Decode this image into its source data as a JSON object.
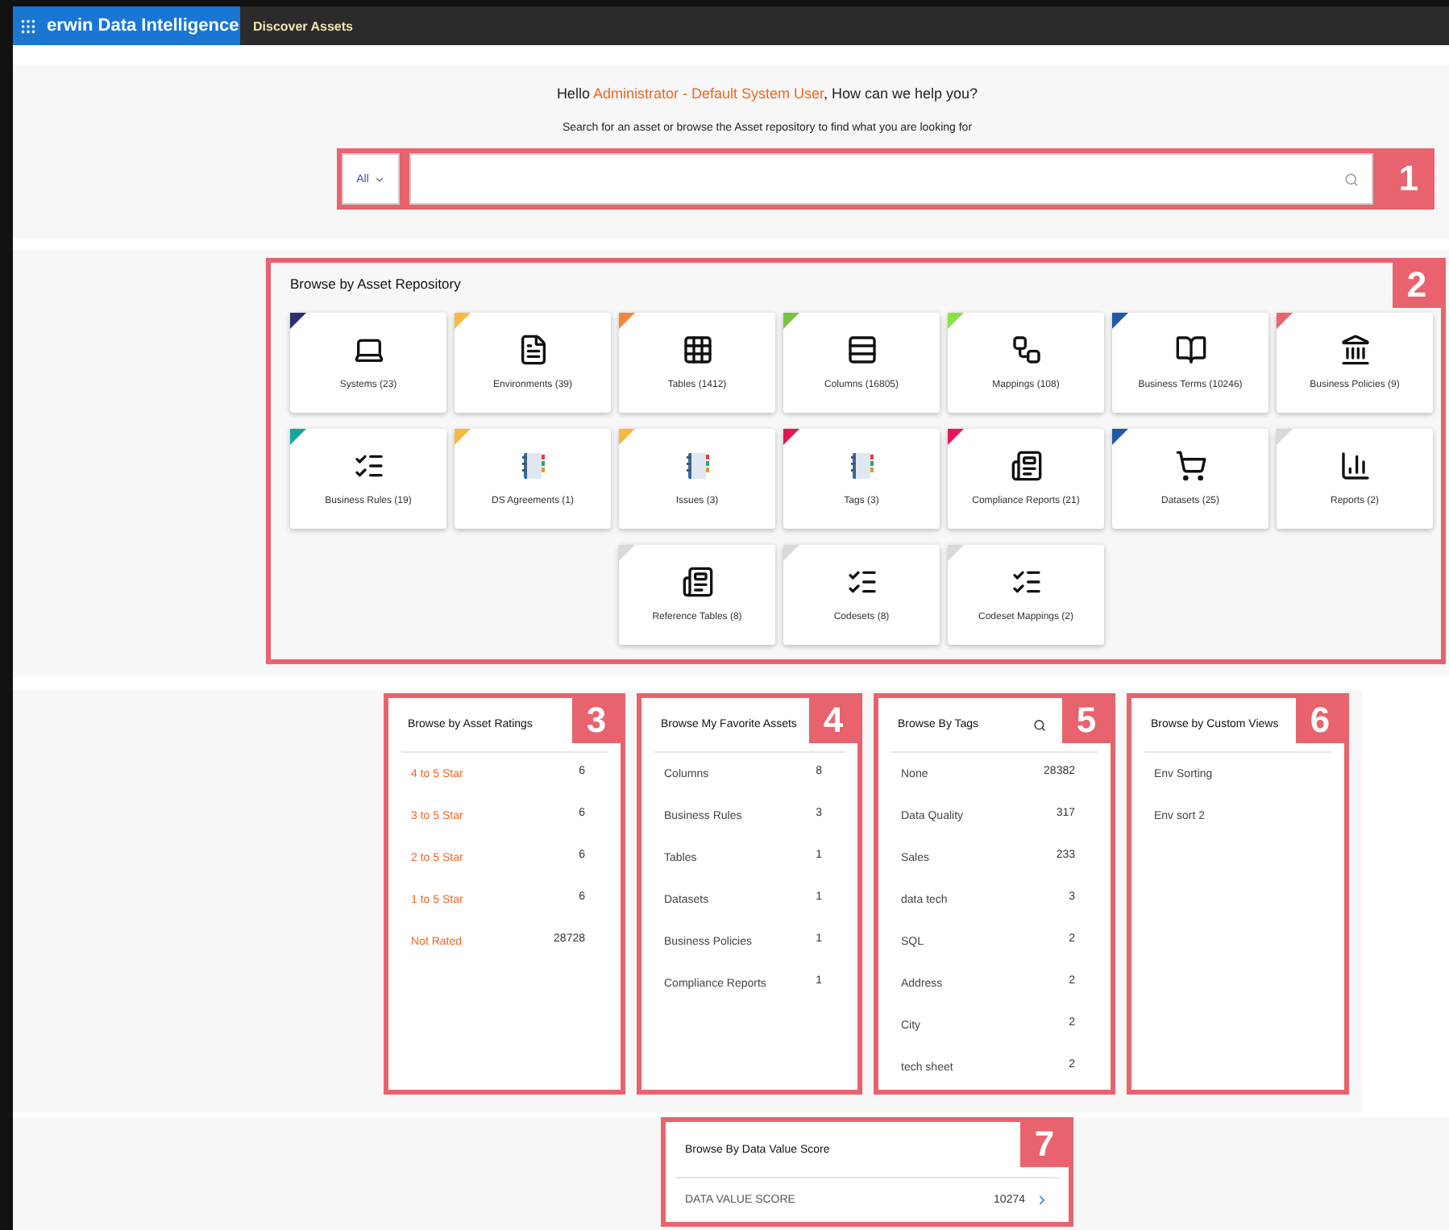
{
  "topbar": {
    "app_title": "erwin Data Intelligence",
    "nav": [
      {
        "label": "Discover Assets"
      }
    ]
  },
  "greeting": {
    "prefix": "Hello ",
    "user": "Administrator - Default System User",
    "suffix": ", How can we help you?"
  },
  "subtitle": "Search for an asset or browse the Asset repository to find what you are looking for",
  "search": {
    "scope": "All",
    "callout": "1"
  },
  "repository": {
    "title": "Browse by Asset Repository",
    "callout": "2",
    "cards": [
      {
        "label": "Systems (23)",
        "kind": "laptop",
        "color": "#2a2f6e"
      },
      {
        "label": "Environments (39)",
        "kind": "document",
        "color": "#f5b942"
      },
      {
        "label": "Tables (1412)",
        "kind": "table",
        "color": "#f0883a"
      },
      {
        "label": "Columns (16805)",
        "kind": "columns",
        "color": "#7cc242"
      },
      {
        "label": "Mappings (108)",
        "kind": "mapping",
        "color": "#8be04a"
      },
      {
        "label": "Business Terms (10246)",
        "kind": "book",
        "color": "#1f5aa6"
      },
      {
        "label": "Business Policies (9)",
        "kind": "bank",
        "color": "#e8636e"
      },
      {
        "label": "Business Rules (19)",
        "kind": "checklist",
        "color": "#14a89a"
      },
      {
        "label": "DS Agreements (1)",
        "kind": "notebook",
        "color": "#f5b942"
      },
      {
        "label": "Issues (3)",
        "kind": "notebook",
        "color": "#f5b942"
      },
      {
        "label": "Tags (3)",
        "kind": "notebook",
        "color": "#e0174f"
      },
      {
        "label": "Compliance Reports (21)",
        "kind": "report",
        "color": "#e8175d"
      },
      {
        "label": "Datasets (25)",
        "kind": "cart",
        "color": "#1f5aa6"
      },
      {
        "label": "Reports (2)",
        "kind": "chart",
        "color": "#d9d9d9"
      },
      {
        "label": "Reference Tables (8)",
        "kind": "report",
        "color": "#d9d9d9"
      },
      {
        "label": "Codesets (8)",
        "kind": "checklist",
        "color": "#d9d9d9"
      },
      {
        "label": "Codeset Mappings (2)",
        "kind": "checklist",
        "color": "#d9d9d9"
      }
    ]
  },
  "panels": [
    {
      "title": "Browse by Asset Ratings",
      "callout": "3",
      "kind": "ratings",
      "items": [
        {
          "label": "4 to 5 Star",
          "count": "6"
        },
        {
          "label": "3 to 5 Star",
          "count": "6"
        },
        {
          "label": "2 to 5 Star",
          "count": "6"
        },
        {
          "label": "1 to 5 Star",
          "count": "6"
        },
        {
          "label": "Not Rated",
          "count": "28728"
        }
      ]
    },
    {
      "title": "Browse My Favorite Assets",
      "callout": "4",
      "kind": "list",
      "items": [
        {
          "label": "Columns",
          "count": "8"
        },
        {
          "label": "Business Rules",
          "count": "3"
        },
        {
          "label": "Tables",
          "count": "1"
        },
        {
          "label": "Datasets",
          "count": "1"
        },
        {
          "label": "Business Policies",
          "count": "1"
        },
        {
          "label": "Compliance Reports",
          "count": "1"
        }
      ]
    },
    {
      "title": "Browse By Tags",
      "callout": "5",
      "kind": "searchable",
      "items": [
        {
          "label": "None",
          "count": "28382"
        },
        {
          "label": "Data Quality",
          "count": "317"
        },
        {
          "label": "Sales",
          "count": "233"
        },
        {
          "label": "data tech",
          "count": "3"
        },
        {
          "label": "SQL",
          "count": "2"
        },
        {
          "label": "Address",
          "count": "2"
        },
        {
          "label": "City",
          "count": "2"
        },
        {
          "label": "tech sheet",
          "count": "2"
        }
      ]
    },
    {
      "title": "Browse by Custom Views",
      "callout": "6",
      "kind": "list",
      "items": [
        {
          "label": "Env Sorting"
        },
        {
          "label": "Env sort 2"
        }
      ]
    }
  ],
  "score": {
    "title": "Browse By Data Value Score",
    "callout": "7",
    "label": "DATA VALUE SCORE",
    "value": "10274"
  }
}
